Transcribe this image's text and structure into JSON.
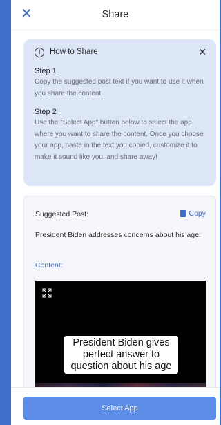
{
  "header": {
    "title": "Share",
    "close_icon": "close-icon"
  },
  "how_to": {
    "title": "How to Share",
    "icon": "info-icon",
    "steps": [
      {
        "title": "Step 1",
        "text": "Copy the suggested post text if you want to use it when you share the content."
      },
      {
        "title": "Step 2",
        "text": "Use the \"Select App\" button below to select the app where you want to share the content. Once you choose your app, paste in the text you copied, customize it to make it sound like you, and share away!"
      }
    ]
  },
  "post": {
    "suggested_label": "Suggested Post:",
    "copy_label": "Copy",
    "text": "President Biden addresses concerns about his age.",
    "content_label": "Content:",
    "video_caption": "President Biden gives perfect answer to question about his age"
  },
  "footer": {
    "select_label": "Select App"
  },
  "colors": {
    "accent": "#3d6fc8",
    "button": "#5b8ce6",
    "info_bg": "#dde6f7"
  }
}
